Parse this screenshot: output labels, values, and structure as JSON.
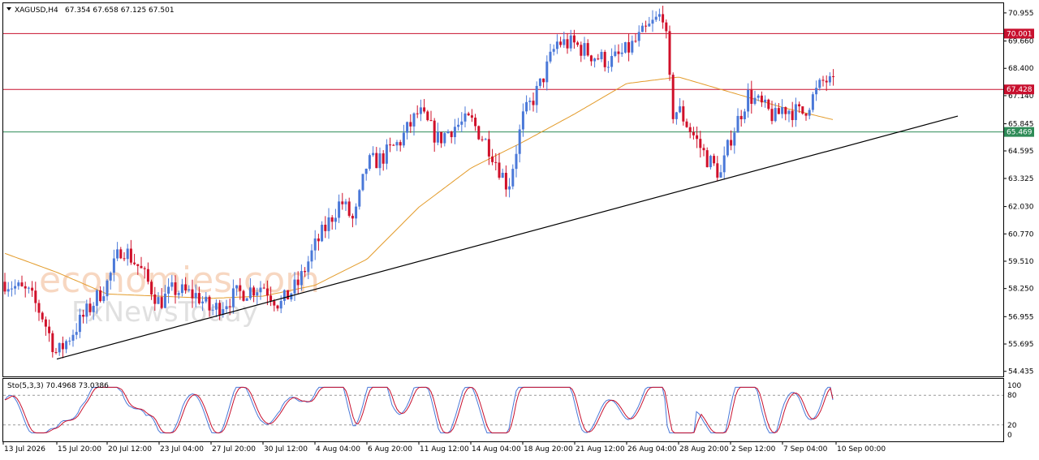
{
  "header": {
    "symbol": "XAGUSD,H4",
    "ohlc": "67.354 67.658 67.125 67.501"
  },
  "watermark": {
    "line1": "economies.com",
    "line2": "FxNewsToday"
  },
  "colors": {
    "bull": "#4a78d8",
    "bear": "#d0102a",
    "ma": "#e39b2a",
    "resistance": "#c8102e",
    "support": "#2e8b57",
    "trendline": "#000000",
    "stoch_main": "#4a78d8",
    "stoch_signal": "#c8102e"
  },
  "chart_data": [
    {
      "type": "candlestick",
      "symbol": "XAGUSD",
      "timeframe": "H4",
      "y_ticks": [
        "70.955",
        "69.660",
        "68.400",
        "67.140",
        "65.845",
        "64.595",
        "63.325",
        "62.030",
        "60.770",
        "59.510",
        "58.250",
        "56.955",
        "55.695",
        "54.435"
      ],
      "ylim": [
        54.2,
        71.4
      ],
      "x_ticks": [
        "13 Jul 2026",
        "15 Jul 20:00",
        "20 Jul 12:00",
        "23 Jul 04:00",
        "27 Jul 20:00",
        "30 Jul 12:00",
        "4 Aug 04:00",
        "6 Aug 20:00",
        "11 Aug 12:00",
        "14 Aug 04:00",
        "18 Aug 20:00",
        "21 Aug 12:00",
        "26 Aug 04:00",
        "28 Aug 20:00",
        "2 Sep 12:00",
        "7 Sep 04:00",
        "10 Sep 00:00"
      ],
      "horizontal_levels": [
        {
          "label": "70.001",
          "value": 70.001,
          "color": "#c8102e"
        },
        {
          "label": "67.428",
          "value": 67.428,
          "color": "#c8102e"
        },
        {
          "label": "65.469",
          "value": 65.469,
          "color": "#2e8b57"
        }
      ],
      "trendline": {
        "start": {
          "x": "15 Jul 20:00",
          "y": 55.0
        },
        "end": {
          "x": "12 Sep",
          "y": 66.2
        }
      },
      "price_path": [
        [
          "13 Jul 2026",
          58.6
        ],
        [
          "14 Jul",
          58.0
        ],
        [
          "15 Jul 04:00",
          57.0
        ],
        [
          "15 Jul 20:00",
          55.2
        ],
        [
          "17 Jul",
          56.8
        ],
        [
          "20 Jul 12:00",
          58.5
        ],
        [
          "21 Jul",
          60.2
        ],
        [
          "22 Jul",
          59.2
        ],
        [
          "23 Jul 04:00",
          57.6
        ],
        [
          "24 Jul",
          58.2
        ],
        [
          "27 Jul",
          57.9
        ],
        [
          "27 Jul 20:00",
          57.2
        ],
        [
          "29 Jul",
          58.0
        ],
        [
          "30 Jul 12:00",
          58.4
        ],
        [
          "31 Jul",
          57.5
        ],
        [
          "3 Aug",
          58.5
        ],
        [
          "4 Aug 04:00",
          60.2
        ],
        [
          "5 Aug",
          62.3
        ],
        [
          "6 Aug 04:00",
          61.3
        ],
        [
          "6 Aug 20:00",
          64.0
        ],
        [
          "7 Aug",
          64.2
        ],
        [
          "10 Aug",
          65.0
        ],
        [
          "11 Aug 12:00",
          66.4
        ],
        [
          "12 Aug",
          65.1
        ],
        [
          "13 Aug",
          65.7
        ],
        [
          "14 Aug 04:00",
          66.0
        ],
        [
          "15 Aug",
          64.7
        ],
        [
          "17 Aug",
          62.9
        ],
        [
          "18 Aug 20:00",
          66.1
        ],
        [
          "19 Aug",
          67.5
        ],
        [
          "20 Aug",
          69.6
        ],
        [
          "21 Aug 12:00",
          69.5
        ],
        [
          "24 Aug",
          69.0
        ],
        [
          "25 Aug",
          68.7
        ],
        [
          "26 Aug 04:00",
          69.2
        ],
        [
          "27 Aug",
          71.0
        ],
        [
          "27 Aug 12:00",
          66.3
        ],
        [
          "28 Aug 20:00",
          66.5
        ],
        [
          "30 Aug",
          64.3
        ],
        [
          "1 Sep",
          63.5
        ],
        [
          "2 Sep 12:00",
          65.2
        ],
        [
          "3 Sep",
          67.2
        ],
        [
          "4 Sep",
          66.6
        ],
        [
          "6 Sep",
          66.1
        ],
        [
          "7 Sep 04:00",
          66.6
        ],
        [
          "8 Sep",
          66.3
        ],
        [
          "9 Sep",
          67.9
        ],
        [
          "10 Sep 00:00",
          67.5
        ]
      ],
      "ma_path": [
        [
          "13 Jul 2026",
          59.9
        ],
        [
          "15 Jul 20:00",
          59.0
        ],
        [
          "20 Jul 12:00",
          58.0
        ],
        [
          "27 Jul 20:00",
          57.8
        ],
        [
          "30 Jul 12:00",
          57.9
        ],
        [
          "4 Aug 04:00",
          58.4
        ],
        [
          "6 Aug 20:00",
          59.6
        ],
        [
          "11 Aug 12:00",
          62.0
        ],
        [
          "14 Aug 04:00",
          63.8
        ],
        [
          "18 Aug 20:00",
          65.0
        ],
        [
          "21 Aug 12:00",
          66.3
        ],
        [
          "26 Aug 04:00",
          67.7
        ],
        [
          "28 Aug 20:00",
          68.0
        ],
        [
          "2 Sep 12:00",
          67.3
        ],
        [
          "7 Sep 04:00",
          66.6
        ],
        [
          "10 Sep 00:00",
          66.0
        ]
      ]
    },
    {
      "type": "line",
      "title": "Sto(5,3,3) 70.4968 73.0386",
      "y_ticks": [
        "100",
        "80",
        "20",
        "0"
      ],
      "ylim": [
        0,
        100
      ],
      "levels": [
        80,
        20
      ],
      "main_value": 70.4968,
      "signal_value": 73.0386
    }
  ]
}
